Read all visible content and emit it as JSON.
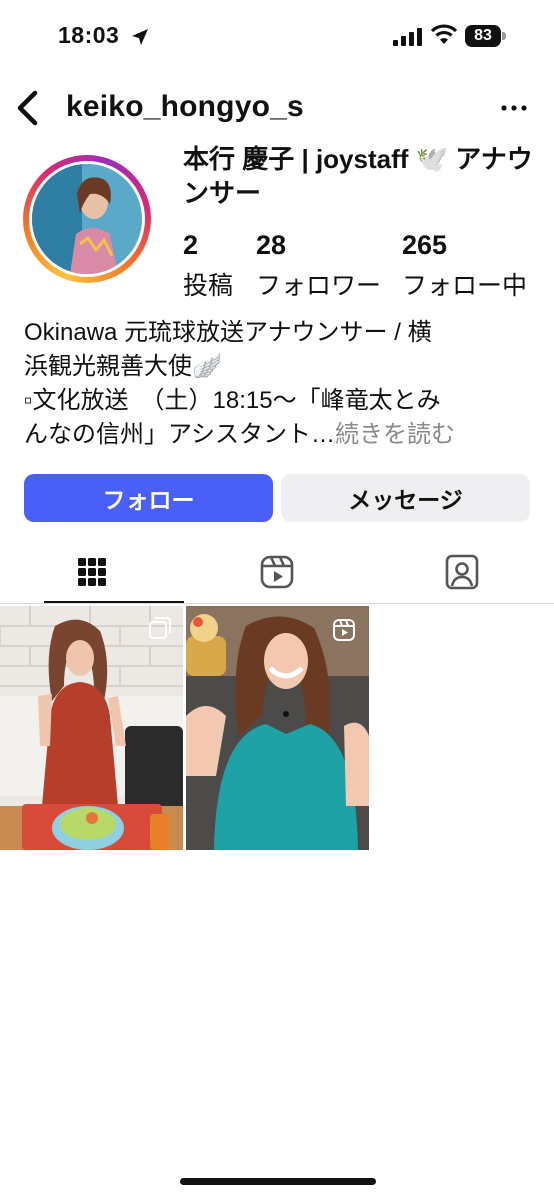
{
  "status_bar": {
    "time": "18:03",
    "battery": "83"
  },
  "header": {
    "username": "keiko_hongyo_s"
  },
  "profile": {
    "display_name": "本行 慶子 | joystaff 🕊️ アナウンサー",
    "stats": [
      {
        "value": "2",
        "label": "投稿"
      },
      {
        "value": "28",
        "label": "フォロワー"
      },
      {
        "value": "265",
        "label": "フォロー中"
      }
    ],
    "bio": {
      "line1": "Okinawa 元琉球放送アナウンサー / 横",
      "line2": "浜観光親善大使🪽",
      "line3": "▫文化放送　（土）18:15～「峰竜太とみ",
      "line4": "んなの信州」アシスタント…",
      "more": "続きを読む"
    }
  },
  "actions": {
    "follow": "フォロー",
    "message": "メッセージ"
  },
  "tabs": [
    {
      "icon": "grid-icon",
      "active": true
    },
    {
      "icon": "reels-icon",
      "active": false
    },
    {
      "icon": "tagged-icon",
      "active": false
    }
  ],
  "posts": [
    {
      "type": "carousel",
      "badge_icon": "carousel-icon"
    },
    {
      "type": "reel",
      "badge_icon": "reels-badge-icon"
    }
  ],
  "colors": {
    "follow_button": "#4a5ff5",
    "message_button": "#efeff1",
    "accent_ring": "#d92a74"
  }
}
